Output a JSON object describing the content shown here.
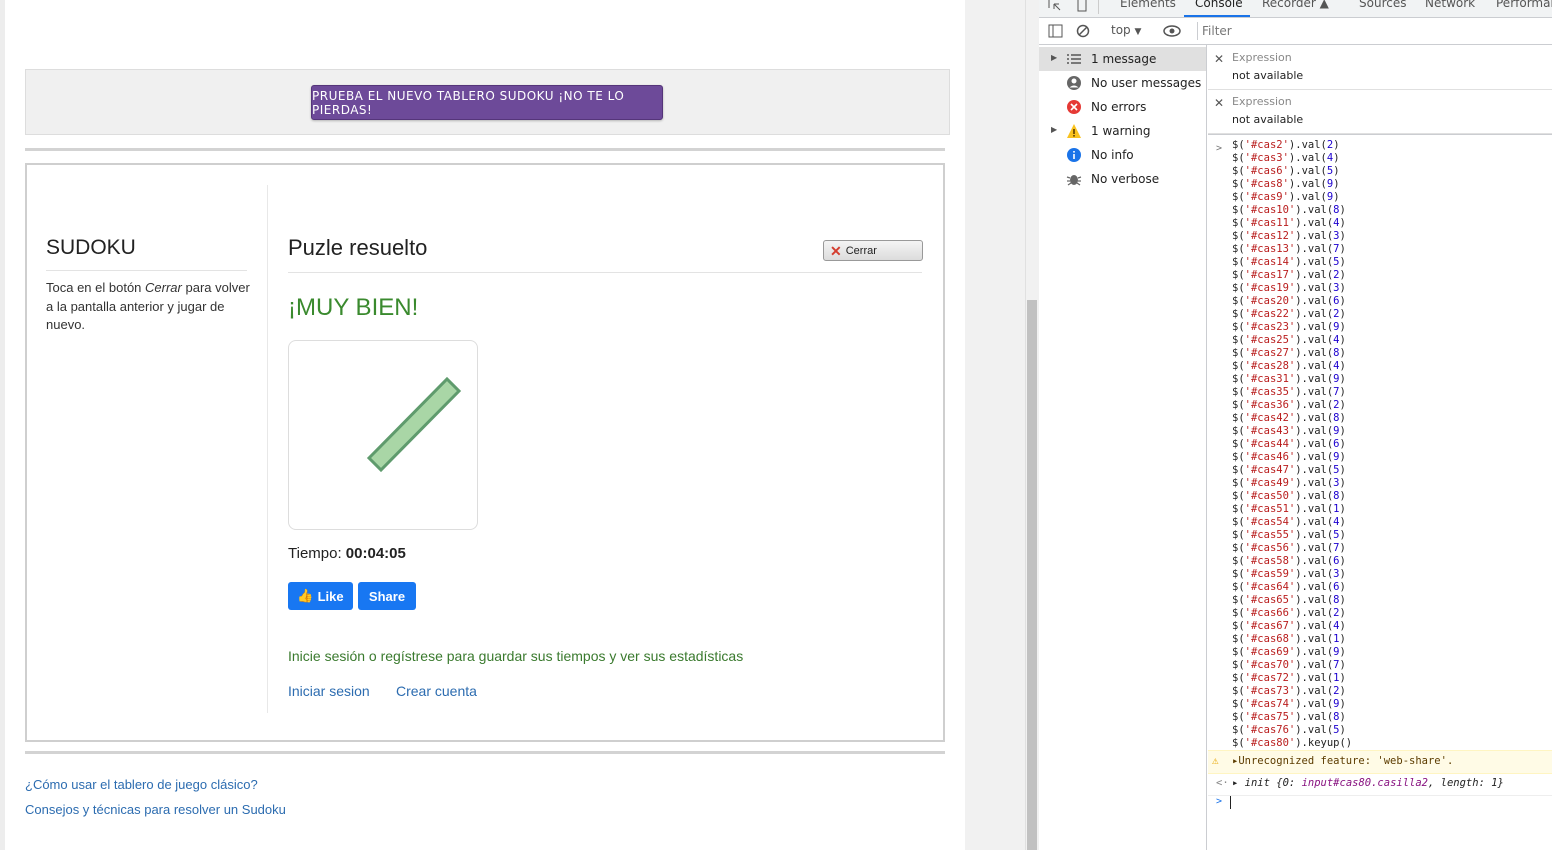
{
  "site": {
    "promo_button": "PRUEBA EL NUEVO TABLERO SUDOKU ¡NO TE LO PIERDAS!",
    "sidebar_title": "SUDOKU",
    "sidebar_text_before": "Toca en el botón ",
    "sidebar_text_em": "Cerrar",
    "sidebar_text_after": " para volver a la pantalla anterior y jugar de nuevo.",
    "main_title": "Puzle resuelto",
    "close_button": "Cerrar",
    "success_message": "¡MUY BIEN!",
    "time_label": "Tiempo: ",
    "time_value": "00:04:05",
    "like_button": "Like",
    "share_button": "Share",
    "login_prompt": "Inicie sesión o regístrese para guardar sus tiempos y ver sus estadísticas",
    "login_link": "Iniciar sesion",
    "register_link": "Crear cuenta",
    "footer_links": [
      "¿Cómo usar el tablero de juego clásico?",
      "Consejos y técnicas para resolver un Sudoku"
    ]
  },
  "devtools": {
    "tabs": [
      "Elements",
      "Console",
      "Recorder",
      "Sources",
      "Network",
      "Performar"
    ],
    "active_tab": "Console",
    "context": "top",
    "filter_placeholder": "Filter",
    "sidebar": [
      {
        "label": "1 message",
        "icon": "list-icon",
        "expandable": true,
        "selected": true
      },
      {
        "label": "No user messages",
        "icon": "user-icon",
        "expandable": false,
        "selected": false
      },
      {
        "label": "No errors",
        "icon": "error-icon",
        "expandable": false,
        "selected": false
      },
      {
        "label": "1 warning",
        "icon": "warning-icon",
        "expandable": true,
        "selected": false
      },
      {
        "label": "No info",
        "icon": "info-icon",
        "expandable": false,
        "selected": false
      },
      {
        "label": "No verbose",
        "icon": "bug-icon",
        "expandable": false,
        "selected": false
      }
    ],
    "expressions": [
      {
        "key": "Expression",
        "value": "not available"
      },
      {
        "key": "Expression",
        "value": "not available"
      }
    ],
    "commands": [
      [
        "cas2",
        "2"
      ],
      [
        "cas3",
        "4"
      ],
      [
        "cas6",
        "5"
      ],
      [
        "cas8",
        "9"
      ],
      [
        "cas9",
        "9"
      ],
      [
        "cas10",
        "8"
      ],
      [
        "cas11",
        "4"
      ],
      [
        "cas12",
        "3"
      ],
      [
        "cas13",
        "7"
      ],
      [
        "cas14",
        "5"
      ],
      [
        "cas17",
        "2"
      ],
      [
        "cas19",
        "3"
      ],
      [
        "cas20",
        "6"
      ],
      [
        "cas22",
        "2"
      ],
      [
        "cas23",
        "9"
      ],
      [
        "cas25",
        "4"
      ],
      [
        "cas27",
        "8"
      ],
      [
        "cas28",
        "4"
      ],
      [
        "cas31",
        "9"
      ],
      [
        "cas35",
        "7"
      ],
      [
        "cas36",
        "2"
      ],
      [
        "cas42",
        "8"
      ],
      [
        "cas43",
        "9"
      ],
      [
        "cas44",
        "6"
      ],
      [
        "cas46",
        "9"
      ],
      [
        "cas47",
        "5"
      ],
      [
        "cas49",
        "3"
      ],
      [
        "cas50",
        "8"
      ],
      [
        "cas51",
        "1"
      ],
      [
        "cas54",
        "4"
      ],
      [
        "cas55",
        "5"
      ],
      [
        "cas56",
        "7"
      ],
      [
        "cas58",
        "6"
      ],
      [
        "cas59",
        "3"
      ],
      [
        "cas64",
        "6"
      ],
      [
        "cas65",
        "8"
      ],
      [
        "cas66",
        "2"
      ],
      [
        "cas67",
        "4"
      ],
      [
        "cas68",
        "1"
      ],
      [
        "cas69",
        "9"
      ],
      [
        "cas70",
        "7"
      ],
      [
        "cas72",
        "1"
      ],
      [
        "cas73",
        "2"
      ],
      [
        "cas74",
        "9"
      ],
      [
        "cas75",
        "8"
      ],
      [
        "cas76",
        "5"
      ]
    ],
    "last_command_id": "cas80",
    "last_command_method": ".keyup()",
    "warning": "Unrecognized feature: 'web-share'.",
    "result_prefix": "init {0: ",
    "result_obj": "input#cas80.casilla2",
    "result_suffix": ", length: 1}"
  }
}
